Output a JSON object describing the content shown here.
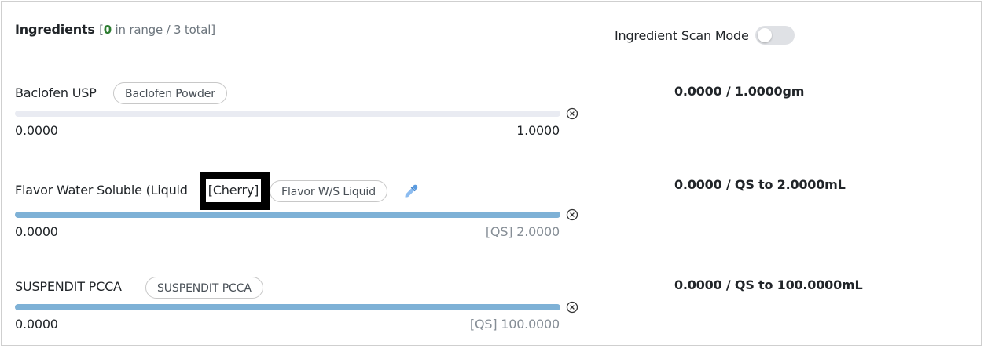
{
  "header": {
    "title": "Ingredients",
    "count_open": "[",
    "in_range": "0",
    "count_rest": " in range / 3 total]"
  },
  "scan_mode": {
    "label": "Ingredient Scan Mode",
    "enabled": false
  },
  "ingredients": [
    {
      "name": "Baclofen USP",
      "chip": "Baclofen Powder",
      "min": "0.0000",
      "max": "1.0000",
      "fill_fraction": 0,
      "amount": "0.0000 /  1.0000gm"
    },
    {
      "name": "Flavor Water Soluble (Liquid",
      "flavor": "[Cherry]",
      "chip": "Flavor W/S Liquid",
      "min": "0.0000",
      "max": "[QS] 2.0000",
      "fill_fraction": 1,
      "amount": "0.0000 / QS to 2.0000mL"
    },
    {
      "name": "SUSPENDIT PCCA",
      "chip": "SUSPENDIT PCCA",
      "min": "0.0000",
      "max": "[QS] 100.0000",
      "fill_fraction": 1,
      "amount": "0.0000 / QS to 100.0000mL"
    }
  ],
  "colors": {
    "track": "#e9ebf2",
    "track_fill": "#7eb1d6",
    "in_range": "#2e7d32",
    "toggle_off": "#dfe1e5"
  },
  "icons": {
    "remove": "circle-x-icon",
    "dropper": "eyedropper-icon"
  }
}
